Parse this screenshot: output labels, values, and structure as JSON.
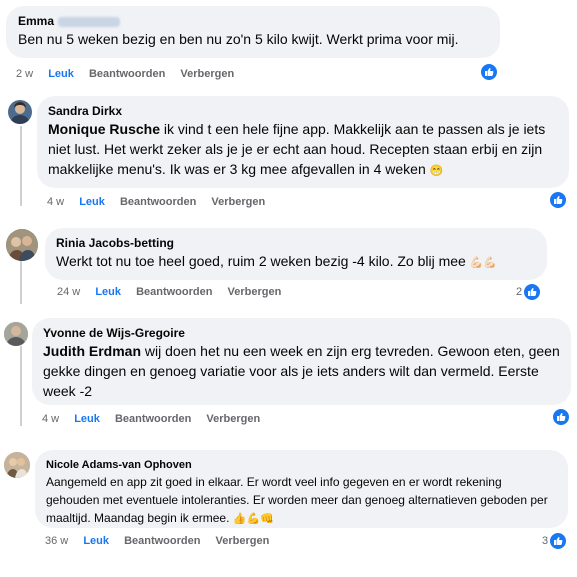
{
  "colors": {
    "accent": "#1877f2",
    "bubble": "#f0f2f5",
    "meta": "#65676b"
  },
  "actions": {
    "like": "Leuk",
    "reply": "Beantwoorden",
    "hide": "Verbergen"
  },
  "comments": [
    {
      "author": "Emma",
      "author_surname_hidden": true,
      "mention": "",
      "text": "Ben nu 5 weken bezig en ben nu zo'n 5 kilo kwijt. Werkt prima voor mij.",
      "time": "2 w",
      "reaction_icon": "like-icon",
      "reaction_count": ""
    },
    {
      "author": "Sandra Dirkx",
      "mention": "Monique Rusche",
      "text": " ik vind t een hele fijne app. Makkelijk aan te passen als je iets niet lust. Het werkt zeker als je je er echt aan houd. Recepten staan erbij en zijn makkelijke menu's. Ik was er 3 kg mee afgevallen in 4 weken",
      "emoji": "😁",
      "time": "4 w",
      "reaction_icon": "like-icon",
      "reaction_count": ""
    },
    {
      "author": "Rinia Jacobs-betting",
      "mention": "",
      "text": "Werkt tot nu toe heel goed, ruim 2 weken bezig -4 kilo. Zo blij mee",
      "emoji": "💪🏻💪🏻",
      "time": "24 w",
      "reaction_icon": "like-icon",
      "reaction_count": "2"
    },
    {
      "author": "Yvonne de Wijs-Gregoire",
      "mention": "Judith Erdman",
      "text": " wij doen het nu een week en zijn erg tevreden. Gewoon eten, geen gekke dingen en genoeg variatie voor als je iets anders wilt dan vermeld. Eerste week -2",
      "time": "4 w",
      "reaction_icon": "like-icon",
      "reaction_count": ""
    },
    {
      "author": "Nicole Adams-van Ophoven",
      "mention": "",
      "text": "Aangemeld en app zit goed in elkaar. Er wordt veel info gegeven en er wordt rekening gehouden met eventuele intoleranties. Er worden meer dan genoeg alternatieven geboden per maaltijd. Maandag begin ik ermee.",
      "emoji": "👍💪👊",
      "time": "36 w",
      "reaction_icon": "like-icon",
      "reaction_count": "3"
    }
  ]
}
